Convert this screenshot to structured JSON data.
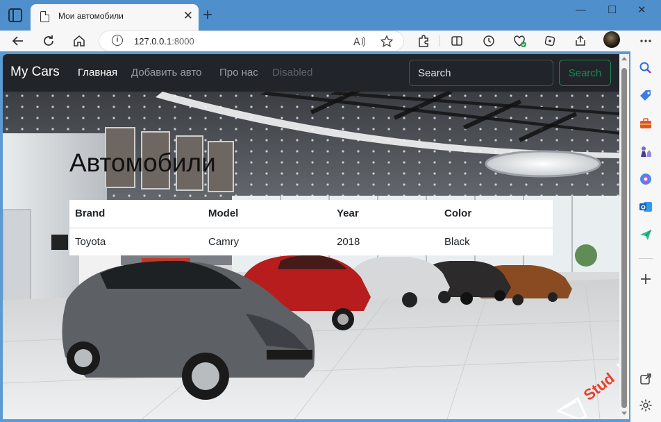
{
  "browser": {
    "tab_title": "Мои автомобили",
    "tab_close": "✕",
    "new_tab": "+",
    "window_controls": {
      "minimize": "—",
      "maximize": "☐",
      "close": "✕"
    },
    "address": {
      "host": "127.0.0.1",
      "port": ":8000"
    },
    "toolbar_icons": [
      "back-icon",
      "refresh-icon",
      "home-icon",
      "read-aloud-icon",
      "favorite-icon",
      "extensions-icon",
      "split-screen-icon",
      "history-icon",
      "performance-icon",
      "collections-icon",
      "share-icon",
      "more-icon"
    ],
    "sidebar_icons": [
      "search-icon",
      "shopping-icon",
      "tools-icon",
      "games-icon",
      "copilot-icon",
      "outlook-icon",
      "send-icon",
      "add-icon",
      "external-link-icon",
      "settings-icon"
    ]
  },
  "navbar": {
    "brand": "My Cars",
    "links": [
      {
        "label": "Главная",
        "state": "active"
      },
      {
        "label": "Добавить авто",
        "state": "normal"
      },
      {
        "label": "Про нас",
        "state": "normal"
      },
      {
        "label": "Disabled",
        "state": "disabled"
      }
    ],
    "search_placeholder": "Search",
    "search_button": "Search"
  },
  "page": {
    "title": "Автомобили",
    "table": {
      "headers": [
        "Brand",
        "Model",
        "Year",
        "Color"
      ],
      "rows": [
        [
          "Toyota",
          "Camry",
          "2018",
          "Black"
        ]
      ]
    }
  },
  "watermark": "StudLearn",
  "colors": {
    "navbar_bg": "#212529",
    "success": "#198754",
    "browser_frame": "#4f90cc"
  }
}
